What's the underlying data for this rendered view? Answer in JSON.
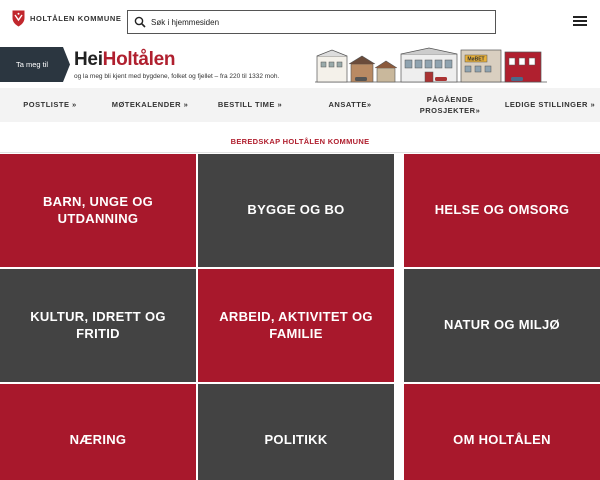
{
  "header": {
    "logo_text": "HOLTÅLEN KOMMUNE",
    "search_placeholder": "Søk i hjemmesiden"
  },
  "banner": {
    "ta_meg_til": "Ta meg til",
    "title_part1": "Hei",
    "title_part2": "Holtålen",
    "subtitle": "og la meg bli kjent med bygdene, folket og fjellet – fra 220 til 1332 moh.",
    "sign_text": "MøBET"
  },
  "nav": {
    "items": [
      {
        "label": "POSTLISTE »"
      },
      {
        "label": "MØTEKALENDER »"
      },
      {
        "label": "BESTILL TIME »"
      },
      {
        "label": "ANSATTE»"
      },
      {
        "label": "PÅGÅENDE PROSJEKTER»"
      },
      {
        "label": "LEDIGE STILLINGER »"
      }
    ]
  },
  "emergency_link": "BEREDSKAP HOLTÅLEN KOMMUNE",
  "tiles": [
    {
      "label": "BARN, UNGE OG UTDANNING"
    },
    {
      "label": "BYGGE OG BO"
    },
    {
      "label": "HELSE OG OMSORG"
    },
    {
      "label": "KULTUR, IDRETT OG FRITID"
    },
    {
      "label": "ARBEID, AKTIVITET OG FAMILIE"
    },
    {
      "label": "NATUR OG MILJØ"
    },
    {
      "label": "NÆRING"
    },
    {
      "label": "POLITIKK"
    },
    {
      "label": "OM HOLTÅLEN"
    }
  ],
  "colors": {
    "brand_red": "#a8182c",
    "tile_gray": "#434343",
    "banner_dark": "#2b3640"
  }
}
